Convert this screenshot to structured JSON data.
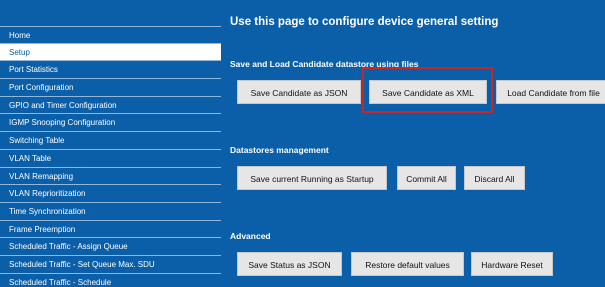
{
  "sidebar": {
    "items": [
      {
        "label": "Home"
      },
      {
        "label": "Setup"
      },
      {
        "label": "Port Statistics"
      },
      {
        "label": "Port Configuration"
      },
      {
        "label": "GPIO and Timer Configuration"
      },
      {
        "label": "IGMP Snooping Configuration"
      },
      {
        "label": "Switching Table"
      },
      {
        "label": "VLAN Table"
      },
      {
        "label": "VLAN Remapping"
      },
      {
        "label": "VLAN Reprioritization"
      },
      {
        "label": "Time Synchronization"
      },
      {
        "label": "Frame Preemption"
      },
      {
        "label": "Scheduled Traffic - Assign Queue"
      },
      {
        "label": "Scheduled Traffic - Set Queue Max. SDU"
      },
      {
        "label": "Scheduled Traffic - Schedule"
      }
    ],
    "active_item": "Setup"
  },
  "main": {
    "title": "Use this page to configure device general setting",
    "sections": {
      "candidate": {
        "label": "Save and Load Candidate datastore using files",
        "save_json": "Save Candidate as JSON",
        "save_xml": "Save Candidate as XML",
        "load": "Load Candidate from file"
      },
      "datastores": {
        "label": "Datastores management",
        "save_running": "Save current Running as Startup",
        "commit_all": "Commit All",
        "discard_all": "Discard All"
      },
      "advanced": {
        "label": "Advanced",
        "save_status": "Save Status as JSON",
        "restore_defaults": "Restore default values",
        "hardware_reset": "Hardware Reset"
      }
    }
  },
  "colors": {
    "background": "#0a5fa8",
    "active_nav": "#ffffff",
    "button": "#e6e6e6",
    "highlight": "#c62828"
  }
}
